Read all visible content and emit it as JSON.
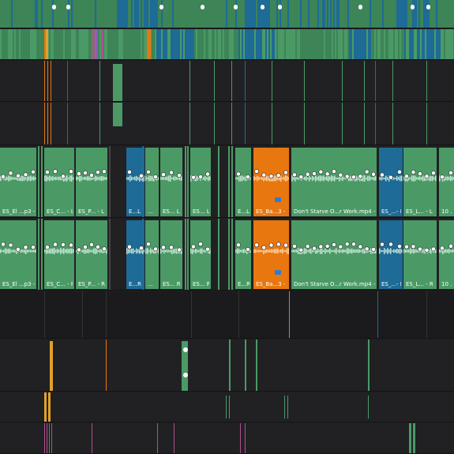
{
  "app": {
    "view": "timeline"
  },
  "colors": {
    "green": "#4b9a66",
    "green_dark": "#3d8457",
    "blue": "#1d6b96",
    "orange": "#e8770f",
    "yellow": "#e0a12a",
    "pink": "#b04f8e",
    "lane_bg": "#212123",
    "waveform": "#cfeedd"
  },
  "audio_track_L": {
    "clips": [
      {
        "label": "ES_El ...p3 - L",
        "color": "green"
      },
      {
        "label": "ES_C... - L",
        "color": "green"
      },
      {
        "label": "ES_P... - L",
        "color": "green"
      },
      {
        "label": "E...L",
        "color": "blue"
      },
      {
        "label": "...",
        "color": "green"
      },
      {
        "label": "ES... L",
        "color": "green"
      },
      {
        "label": "ES... L",
        "color": "green"
      },
      {
        "label": "E...L",
        "color": "green"
      },
      {
        "label": "ES_Ba...3 - L",
        "color": "orange"
      },
      {
        "label": "Don't Starve O...r Work.mp4 - L",
        "color": "green"
      },
      {
        "label": "ES_...- L",
        "color": "blue"
      },
      {
        "label": "ES_L... - L",
        "color": "green"
      },
      {
        "label": "10 ...",
        "color": "green"
      }
    ]
  },
  "audio_track_R": {
    "clips": [
      {
        "label": "ES_El ...p3 - R",
        "color": "green"
      },
      {
        "label": "ES_C... - R",
        "color": "green"
      },
      {
        "label": "ES_P... - R",
        "color": "green"
      },
      {
        "label": "E...R",
        "color": "blue"
      },
      {
        "label": "...",
        "color": "green"
      },
      {
        "label": "ES... R",
        "color": "green"
      },
      {
        "label": "ES... R",
        "color": "green"
      },
      {
        "label": "E...R",
        "color": "green"
      },
      {
        "label": "ES_Ba...3 - R",
        "color": "orange"
      },
      {
        "label": "Don't Starve O...r Work.mp4 - R",
        "color": "green"
      },
      {
        "label": "ES_...- R",
        "color": "blue"
      },
      {
        "label": "ES_L... - R",
        "color": "green"
      },
      {
        "label": "10 ...",
        "color": "green"
      }
    ]
  }
}
